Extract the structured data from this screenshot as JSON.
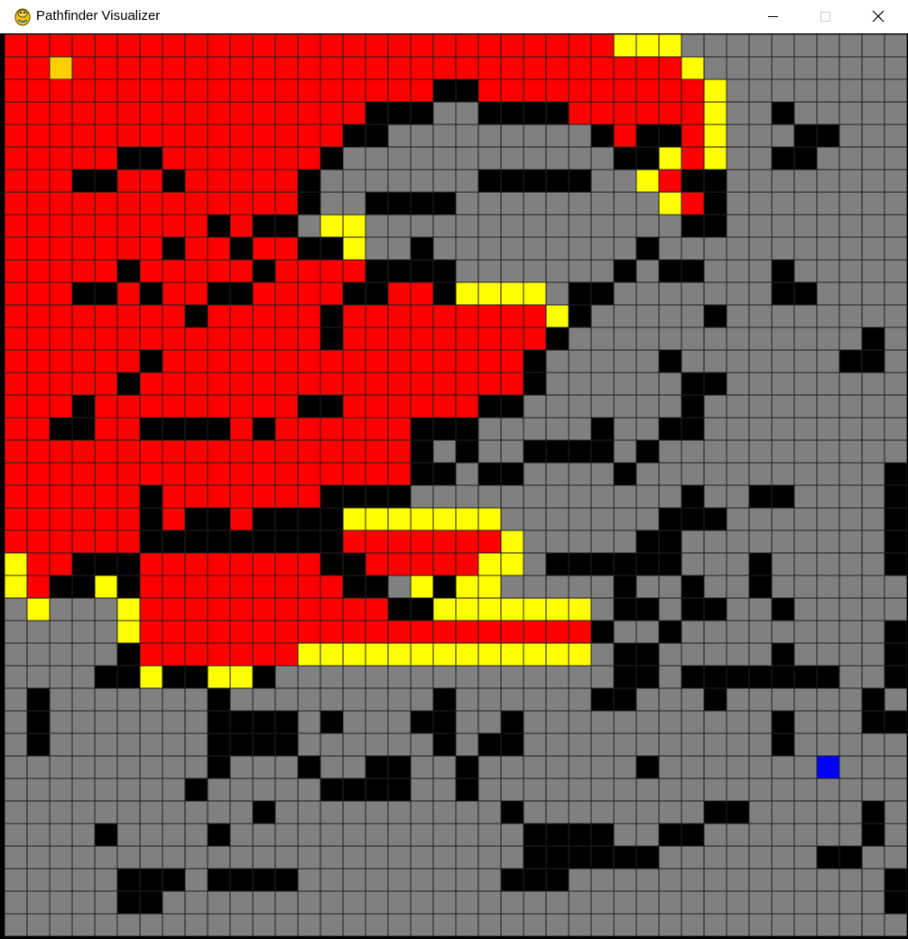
{
  "window": {
    "title": "Pathfinder Visualizer",
    "app_icon": "pygame-snake-icon",
    "controls": [
      "minimize-icon",
      "maximize-icon",
      "close-icon"
    ]
  },
  "grid": {
    "rows": 40,
    "cols": 40,
    "legend": {
      "R": "closed",
      "Y": "open",
      "#": "barrier",
      ".": "unvisited",
      "S": "start",
      "E": "end"
    },
    "colors": {
      "closed": "#ff0000",
      "open": "#ffff00",
      "barrier": "#000000",
      "unvisited": "#808080",
      "start": "#ffd000",
      "end": "#0000ff",
      "line": "#202020"
    },
    "cells": [
      "RRRRRRRRRRRRRRRRRRRRRRRRRRRYYY..........",
      "RRSRRRRRRRRRRRRRRRRRRRRRRRRRRRY.........",
      "RRRRRRRRRRRRRRRRRRR##RRRRRRRRRRY........",
      "RRRRRRRRRRRRRRRR###..####RRRRRRY..#.....",
      "RRRRRRRRRRRRRRR##.........#R##RY...##...",
      "RRRRR##RRRRRRR#............##YRY..##....",
      "RRR##RR#RRRRR#.......#####..YR##........",
      "RRRRRRRRRRRRR#..####.........YR#........",
      "RRRRRRRRR#R##.YY..............##........",
      "RRRRRRR#RR#RR##Y..#.........#...........",
      "RRRRR#RRRRR#RRRR####.......#.##...#.....",
      "RRR##R#RR##RRRR##RR#YYYY.##.......##....",
      "RRRRRRRR#RRRRR#RRRRRRRRRY#.....#........",
      "RRRRRRRRRRRRRR#RRRRRRRRR#.............#.",
      "RRRRRR#RRRRRRRRRRRRRRRR#.....#.......##.",
      "RRRRR#RRRRRRRRRRRRRRRRR#......##........",
      "RRR#RRRRRRRRR##RRRRRR##.......#.........",
      "RR##RR####R#RRRRRR###.....#..##.........",
      "RRRRRRRRRRRRRRRRRR#.#..####.#...........",
      "RRRRRRRRRRRRRRRRRR##.##....#...........#",
      "RRRRRR#RRRRRRR####............#..##....#",
      "RRRRRR#R##R####YYYYYYY.......###.......#",
      "RRRRRR#########RRRRRRRY.....##.........#",
      "YRR###RRRRRRRR##RRRRRYY.######...#.....#",
      "YR##Y#RRRRRRRRR##.Y#YY.....#..#..#......",
      ".Y...YRRRRRRRRRRR##YYYYYYY.##.##..#.....",
      ".....YRRRRRRRRRRRRRRRRRRRR#..#.........#",
      ".....#RRRRRRRYYYYYYYYYYYYY.##.....#....#",
      "....##Y##YY#...............##.#######..#",
      ".#.......#.........#......##...#......#.",
      ".#.......####.#...##..#...........#...##",
      ".#.......####......#.##...........#.....",
      ".........#...#..##..#.......#.......E...",
      "........#.....####..#...................",
      "...........#..........#........##.....#.",
      "....#....#.............####..##.......#.",
      ".......................######.......##..",
      ".....###.####.........###..............#",
      ".....##................................#",
      "........................................"
    ]
  }
}
